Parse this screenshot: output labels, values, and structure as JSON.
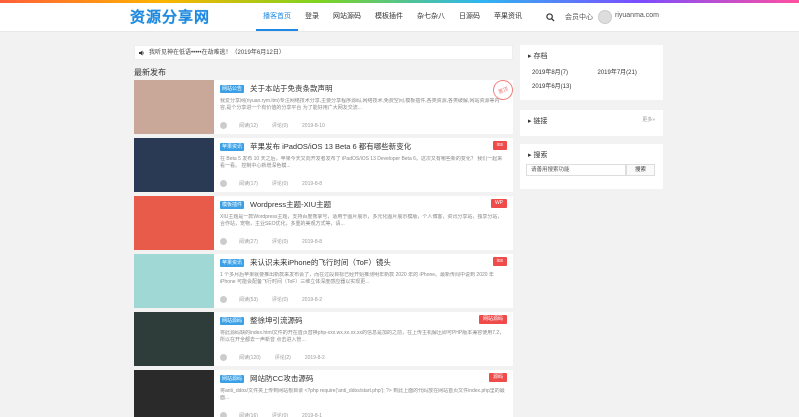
{
  "logo": "资源分享网",
  "nav": [
    "播客首页",
    "登录",
    "网站源码",
    "模板插件",
    "杂七杂八",
    "日源码",
    "苹果资讯"
  ],
  "header_right": {
    "member": "会员中心",
    "site": "riyuanma.com"
  },
  "notice": "我听见神在低语•••••在劫难逃！（2019年6月12日）",
  "latest_title": "最新发布",
  "posts": [
    {
      "tag": "网站公告",
      "title": "关于本站于免责条款声明",
      "excerpt": "我爱分享网(riyuan.rym.ltm)专注网络技术分享,主要分享程序源码,网络技术,免费空间,模板插件,各类资源,各类破解,网站资源等内容,是个分享进一个有价值的分享平台 为了能好用广大网友交流...",
      "author": "阅读(12)",
      "comments": "评论(0)",
      "date": "2019-8-10",
      "badge": "",
      "stamp": "置顶",
      "thumb_color": "#c9a89a"
    },
    {
      "tag": "苹果资讯",
      "title": "苹果发布 iPadOS/iOS 13 Beta 6 都有哪些新变化",
      "excerpt": "在 Beta 5 发布 10 天之后，苹果今天又向开发者发布了 iPadOS/iOS 13 Developer Beta 6。这次又有哪些新的变化？ 我们一起来看一看。 控制中心新增深色模...",
      "author": "阅读(17)",
      "comments": "评论(0)",
      "date": "2019-8-8",
      "badge": "ios",
      "stamp": "",
      "thumb_color": "#2a3a55"
    },
    {
      "tag": "模板插件",
      "title": "Wordpress主题-XIU主题",
      "excerpt": "XIU主题是一款Wordpress主题，支持百度熊掌号，适用于图片展示，多元化图片展示模版，个人博客，资讯分享站，独享分站，合作站，宠物，主业SEO优化，多重的美观方式等，请...",
      "author": "阅读(27)",
      "comments": "评论(0)",
      "date": "2019-8-8",
      "badge": "WP",
      "stamp": "",
      "thumb_color": "#e85a4a"
    },
    {
      "tag": "苹果资讯",
      "title": "来认识未来iPhone的飞行时间（ToF）镜头",
      "excerpt": "1 个多月后苹果就要推出新款来发布会了，而在过段目标已经开始推测明年新款 2020 年的 iPhone。最新传闻中说到 2020 年 iPhone 可能会配备飞行时间（ToF）三维立体深度感应器以实现更...",
      "author": "阅读(53)",
      "comments": "评论(0)",
      "date": "2019-8-2",
      "badge": "ios",
      "stamp": "",
      "thumb_color": "#9fd8d4"
    },
    {
      "tag": "网站源码",
      "title": "整徐坤引流源码",
      "excerpt": "将此源码缺的index.html文件的开在首页替换php-xxx.wx.xx.xx.xx的信息是加的之前，在上传主机解压即可PHP版本兼容使用7.2，所以在开全都去一声新音 点击进入管…",
      "author": "阅读(120)",
      "comments": "评论(2)",
      "date": "2019-8-2",
      "badge": "网站源码",
      "stamp": "",
      "thumb_color": "#2f3d3a"
    },
    {
      "tag": "网站源码",
      "title": "网站防CC攻击源码",
      "excerpt": "将anti_ddos/文件夹上传到网站根目录 <?php require('anti_ddos/start.php'); ?> 到此上面的代码放在网站首页文件index.php里的最面...",
      "author": "阅读(16)",
      "comments": "评论(0)",
      "date": "2019-8-1",
      "badge": "源码",
      "stamp": "",
      "thumb_color": "#2a2a2a"
    }
  ],
  "sidebar": {
    "archive_title": "存档",
    "archive": [
      "2019年8月(7)",
      "2019年7月(21)",
      "2019年6月(13)"
    ],
    "links_title": "链接",
    "links_more": "更多»",
    "search_title": "搜索",
    "search_placeholder": "请善用搜索功能",
    "search_button": "搜索"
  }
}
